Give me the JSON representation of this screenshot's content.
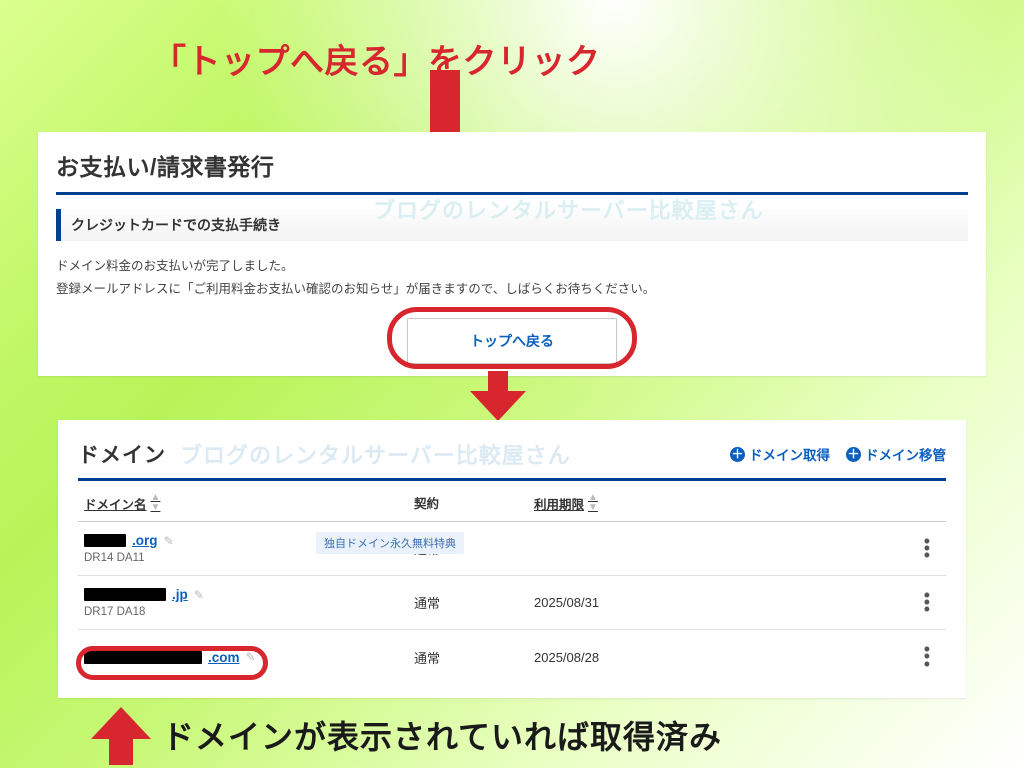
{
  "annotations": {
    "top": "「トップへ戻る」をクリック",
    "bottom": "ドメインが表示されていれば取得済み"
  },
  "panel1": {
    "title": "お支払い/請求書発行",
    "subhead": "クレジットカードでの支払手続き",
    "watermark": "ブログのレンタルサーバー比較屋さん",
    "msg_line1": "ドメイン料金のお支払いが完了しました。",
    "msg_line2": "登録メールアドレスに「ご利用料金お支払い確認のお知らせ」が届きますので、しばらくお待ちください。",
    "back_button": "トップへ戻る"
  },
  "panel2": {
    "title": "ドメイン",
    "watermark": "ブログのレンタルサーバー比較屋さん",
    "actions": {
      "acquire": "ドメイン取得",
      "transfer": "ドメイン移管"
    },
    "columns": {
      "name": "ドメイン名",
      "contract": "契約",
      "expiry": "利用期限"
    },
    "rows": [
      {
        "tld": ".org",
        "drda": "DR14 DA11",
        "badge": "独自ドメイン永久無料特典",
        "contract": "通常",
        "expiry": ""
      },
      {
        "tld": ".jp",
        "drda": "DR17 DA18",
        "badge": "",
        "contract": "通常",
        "expiry": "2025/08/31"
      },
      {
        "tld": ".com",
        "drda": "",
        "badge": "",
        "contract": "通常",
        "expiry": "2025/08/28"
      }
    ]
  }
}
